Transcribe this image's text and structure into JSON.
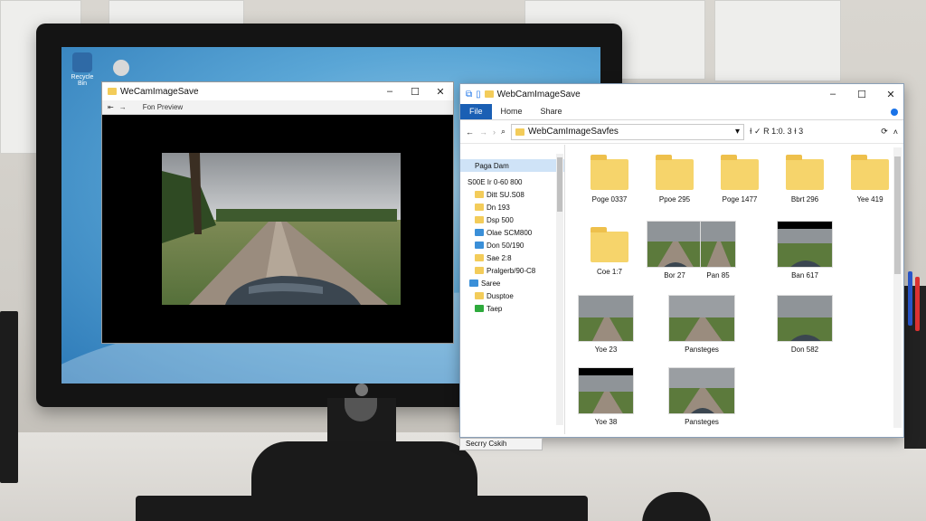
{
  "desktop": {
    "icons": [
      {
        "label": "Recycle Bin",
        "name": "recycle-bin"
      },
      {
        "label": "",
        "name": "drive"
      }
    ]
  },
  "camera_window": {
    "title": "WeCamImageSave",
    "toolbar_label": "Fon Preview"
  },
  "explorer": {
    "title": "WebCamImageSave",
    "ribbon_tabs": [
      "File",
      "Home",
      "Share"
    ],
    "address": "WebCamImageSavfes",
    "search_meta": "Ɨ  ✓  R 1:0. 3 Ɨ 3",
    "nav_items": [
      {
        "label": "Paga Dam",
        "icon": "folder",
        "selected": true
      },
      {
        "label": "S00E Ir 0-60 800",
        "icon": "none"
      },
      {
        "label": "Ditt SU.S08",
        "icon": "folder"
      },
      {
        "label": "Dn 193",
        "icon": "folder"
      },
      {
        "label": "Dsp 500",
        "icon": "folder"
      },
      {
        "label": "Olae SCM800",
        "icon": "folder-blue"
      },
      {
        "label": "Don 50/190",
        "icon": "folder-blue"
      },
      {
        "label": "Sae 2:8",
        "icon": "folder"
      },
      {
        "label": "Pralgerb/90-C8",
        "icon": "folder"
      },
      {
        "label": "Saree",
        "icon": "folder-blue"
      },
      {
        "label": "Dusptoe",
        "icon": "folder"
      },
      {
        "label": "Taep",
        "icon": "folder-green"
      }
    ],
    "items": [
      {
        "label": "Poge 0337",
        "type": "folder"
      },
      {
        "label": "Ppoe 295",
        "type": "folder"
      },
      {
        "label": "Poge 1477",
        "type": "folder"
      },
      {
        "label": "Bbrt 296",
        "type": "folder"
      },
      {
        "label": "Yee 419",
        "type": "folder"
      },
      {
        "label": "Coe 1:7",
        "type": "folder"
      },
      {
        "label": "Bor 27",
        "type": "image"
      },
      {
        "label": "Pan 85",
        "type": "image"
      },
      {
        "label": "Ban 617",
        "type": "image"
      },
      {
        "label": "Yoe 23",
        "type": "image"
      },
      {
        "label": "Pansteges",
        "type": "image"
      },
      {
        "label": "Don 582",
        "type": "image"
      },
      {
        "label": "Yoe 38",
        "type": "image"
      },
      {
        "label": "Pansteges",
        "type": "image"
      }
    ],
    "status_text": "Secrry Cskih"
  },
  "colors": {
    "accent": "#1a5fb4",
    "folder": "#f6d46b"
  }
}
